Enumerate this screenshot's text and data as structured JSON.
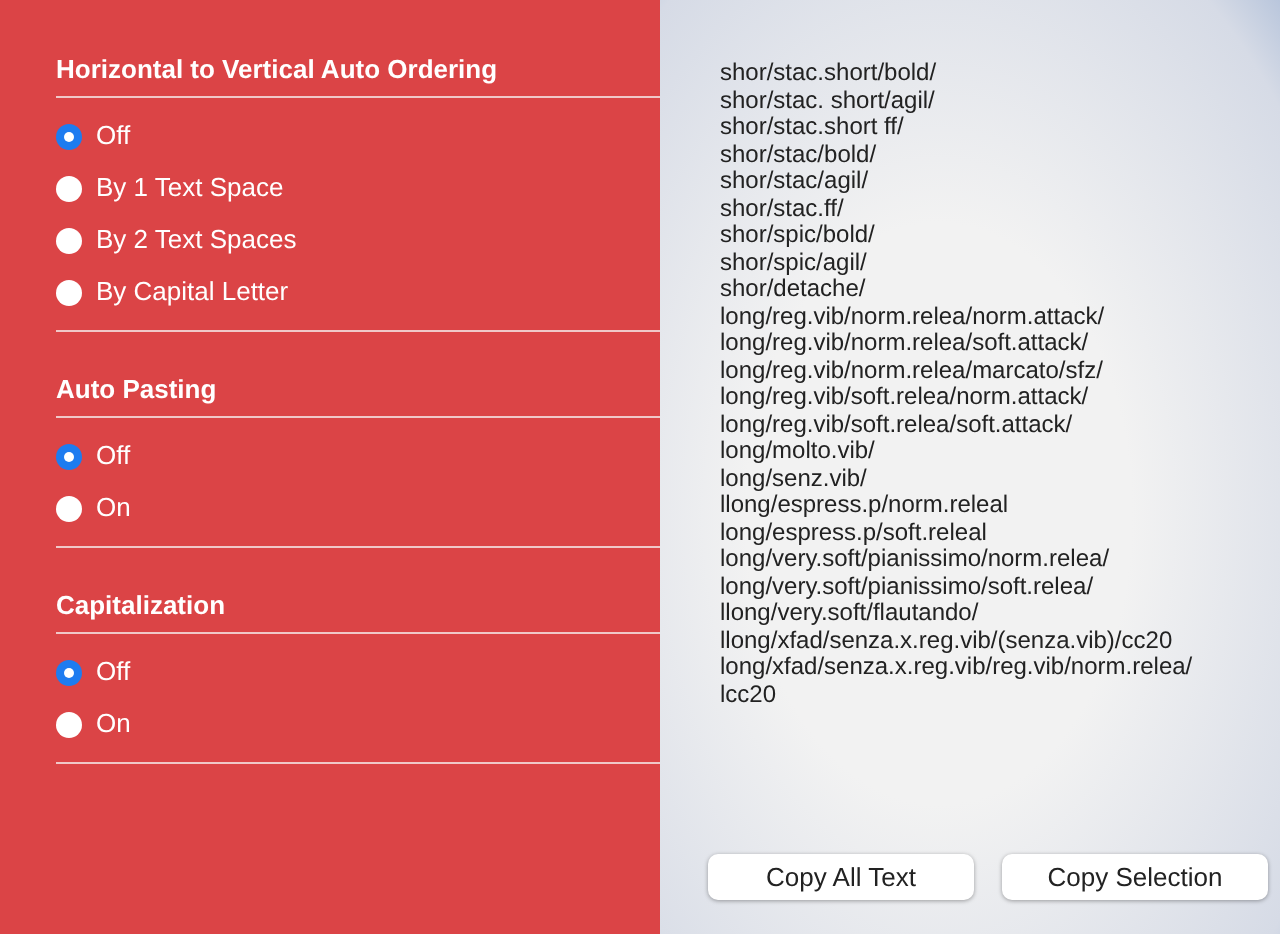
{
  "sections": [
    {
      "title": "Horizontal to Vertical Auto Ordering",
      "options": [
        {
          "label": "Off",
          "selected": true
        },
        {
          "label": "By 1 Text Space",
          "selected": false
        },
        {
          "label": "By 2 Text Spaces",
          "selected": false
        },
        {
          "label": "By Capital Letter",
          "selected": false
        }
      ]
    },
    {
      "title": "Auto Pasting",
      "options": [
        {
          "label": "Off",
          "selected": true
        },
        {
          "label": "On",
          "selected": false
        }
      ]
    },
    {
      "title": "Capitalization",
      "options": [
        {
          "label": "Off",
          "selected": true
        },
        {
          "label": "On",
          "selected": false
        }
      ]
    }
  ],
  "text_lines": [
    "shor/stac.short/bold/",
    "shor/stac. short/agil/",
    "shor/stac.short ff/",
    "shor/stac/bold/",
    "shor/stac/agil/",
    "shor/stac.ff/",
    "shor/spic/bold/",
    "shor/spic/agil/",
    "shor/detache/",
    "long/reg.vib/norm.relea/norm.attack/",
    "long/reg.vib/norm.relea/soft.attack/",
    "long/reg.vib/norm.relea/marcato/sfz/",
    "long/reg.vib/soft.relea/norm.attack/",
    "long/reg.vib/soft.relea/soft.attack/",
    "long/molto.vib/",
    "long/senz.vib/",
    "llong/espress.p/norm.releal",
    "long/espress.p/soft.releal",
    "long/very.soft/pianissimo/norm.relea/",
    "long/very.soft/pianissimo/soft.relea/",
    "llong/very.soft/flautando/",
    "llong/xfad/senza.x.reg.vib/(senza.vib)/cc20",
    "long/xfad/senza.x.reg.vib/reg.vib/norm.relea/",
    "lcc20"
  ],
  "buttons": [
    "Copy All Text",
    "Copy Selection"
  ]
}
